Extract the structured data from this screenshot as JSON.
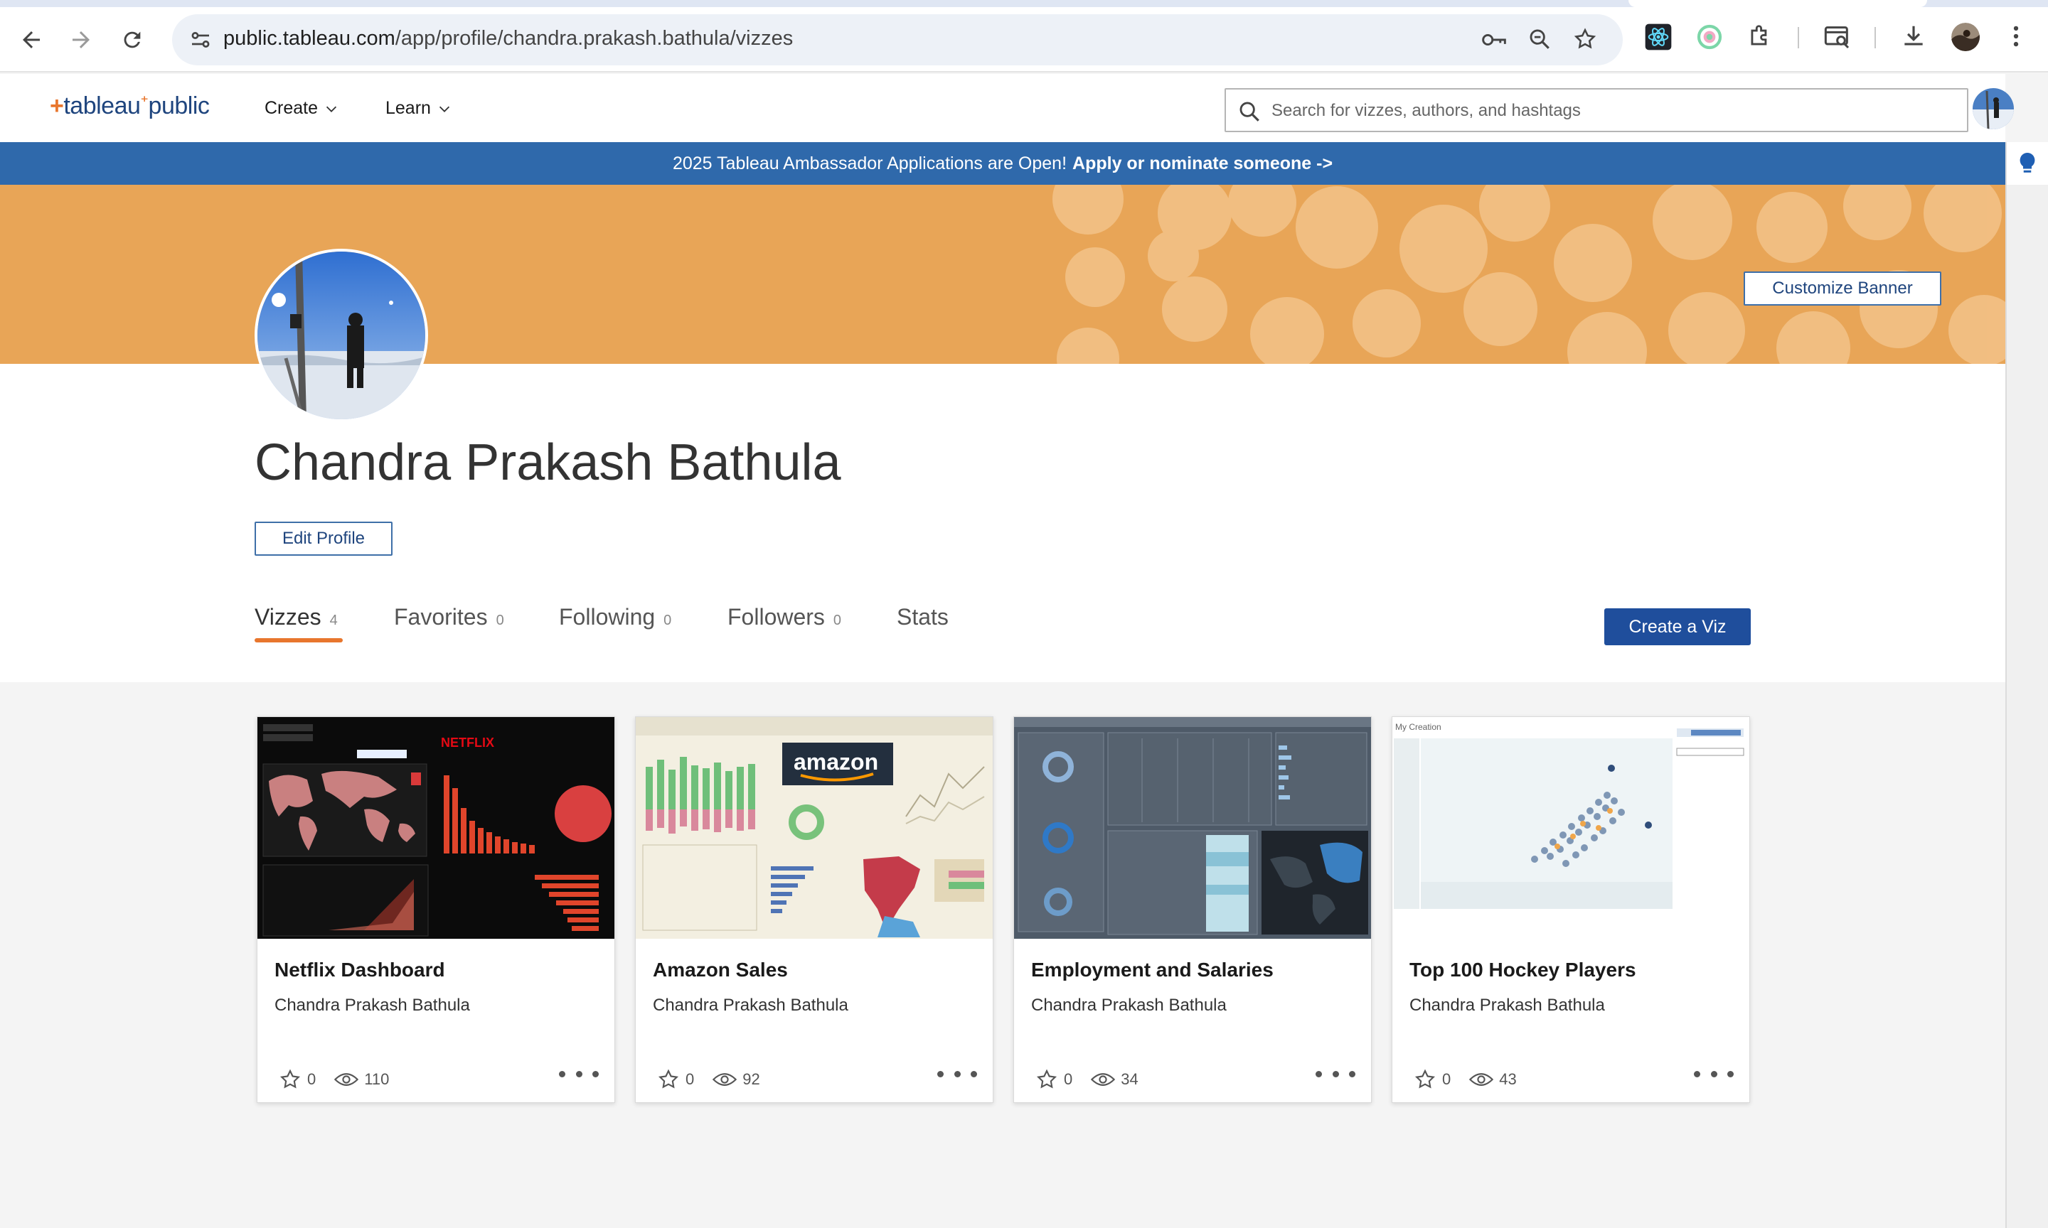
{
  "browser": {
    "url_host": "public.tableau.com",
    "url_path": "/app/profile/chandra.prakash.bathula/vizzes",
    "icons": [
      "back-icon",
      "forward-icon",
      "reload-icon",
      "site-info-icon",
      "password-key-icon",
      "zoom-icon",
      "bookmark-star-icon",
      "react-devtools-icon",
      "extension-icon",
      "puzzle-extensions-icon",
      "tab-search-icon",
      "download-icon",
      "profile-icon",
      "kebab-menu-icon"
    ]
  },
  "header": {
    "logo_plus": "+",
    "logo_text": "tableau",
    "logo_public": "public",
    "nav": [
      {
        "label": "Create"
      },
      {
        "label": "Learn"
      }
    ],
    "search_placeholder": "Search for vizzes, authors, and hashtags"
  },
  "announcement": {
    "text": "2025 Tableau Ambassador Applications are Open!",
    "link": "Apply or nominate someone ->"
  },
  "banner": {
    "customize_label": "Customize Banner",
    "color": "#e8a557"
  },
  "profile": {
    "name": "Chandra Prakash Bathula",
    "edit_label": "Edit Profile",
    "create_label": "Create a Viz",
    "tabs": [
      {
        "label": "Vizzes",
        "count": "4"
      },
      {
        "label": "Favorites",
        "count": "0"
      },
      {
        "label": "Following",
        "count": "0"
      },
      {
        "label": "Followers",
        "count": "0"
      },
      {
        "label": "Stats",
        "count": ""
      }
    ]
  },
  "vizzes": [
    {
      "title": "Netflix Dashboard",
      "author": "Chandra Prakash Bathula",
      "favorites": "0",
      "views": "110"
    },
    {
      "title": "Amazon Sales",
      "author": "Chandra Prakash Bathula",
      "favorites": "0",
      "views": "92"
    },
    {
      "title": "Employment and Salaries",
      "author": "Chandra Prakash Bathula",
      "favorites": "0",
      "views": "34"
    },
    {
      "title": "Top 100 Hockey Players",
      "author": "Chandra Prakash Bathula",
      "favorites": "0",
      "views": "43"
    }
  ],
  "thumbnails": {
    "netflix_label": "NETFLIX",
    "amazon_label": "amazon",
    "hockey_label": "My Creation"
  },
  "colors": {
    "accent_orange": "#e8762d",
    "brand_blue": "#1f457e",
    "announce_blue": "#2f69ab",
    "button_blue": "#1f4e9c"
  }
}
